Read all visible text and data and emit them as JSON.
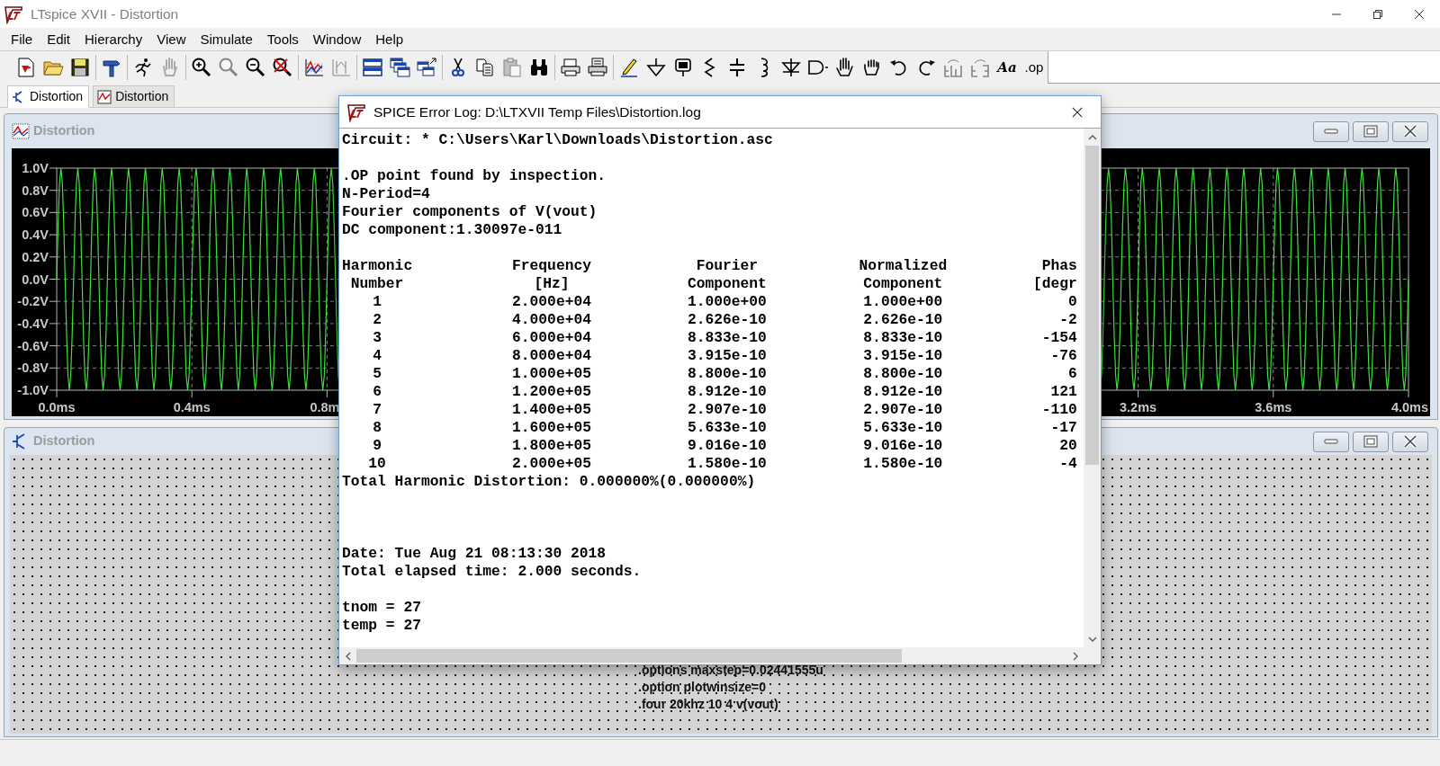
{
  "window": {
    "title": "LTspice XVII - Distortion"
  },
  "menu": [
    "File",
    "Edit",
    "Hierarchy",
    "View",
    "Simulate",
    "Tools",
    "Window",
    "Help"
  ],
  "toolbar": [
    {
      "disabled": false
    },
    {
      "disabled": false
    },
    {
      "disabled": false
    },
    {
      "disabled": false
    },
    {
      "disabled": false
    },
    {
      "disabled": true
    },
    {
      "disabled": false
    },
    {
      "disabled": true
    },
    {
      "disabled": false
    },
    {
      "disabled": false
    },
    {
      "disabled": false
    },
    {
      "disabled": true
    },
    {
      "disabled": false
    },
    {
      "disabled": false
    },
    {
      "disabled": false
    },
    {
      "disabled": false
    },
    {
      "disabled": false
    },
    {
      "disabled": true
    },
    {
      "disabled": false
    },
    {
      "disabled": false
    },
    {
      "disabled": false
    },
    {
      "disabled": false
    },
    {
      "disabled": false
    },
    {
      "disabled": false
    },
    {
      "disabled": false
    },
    {
      "disabled": false
    },
    {
      "disabled": false
    },
    {
      "disabled": false
    },
    {
      "disabled": false
    },
    {
      "disabled": false
    },
    {
      "disabled": false
    },
    {
      "disabled": false
    },
    {
      "disabled": false
    },
    {
      "disabled": true
    },
    {
      "disabled": true
    },
    {
      "disabled": false,
      "label": "Aa"
    },
    {
      "disabled": false,
      "label": ".op"
    }
  ],
  "tabs": [
    {
      "label": "Distortion",
      "kind": "schematic",
      "selected": true
    },
    {
      "label": "Distortion",
      "kind": "waveform",
      "selected": false
    }
  ],
  "waveform_window": {
    "title": "Distortion",
    "y_ticks": [
      "1.0V",
      "0.8V",
      "0.6V",
      "0.4V",
      "0.2V",
      "0.0V",
      "-0.2V",
      "-0.4V",
      "-0.6V",
      "-0.8V",
      "-1.0V"
    ],
    "x_ticks": [
      "0.0ms",
      "0.4ms",
      "0.8m",
      "3.2ms",
      "3.6ms",
      "4.0ms"
    ]
  },
  "schematic_window": {
    "title": "Distortion",
    "directives": [
      ".options maxstep=0.02441555u",
      ".option plotwinsize=0",
      ".four 20khz 10 4 v(vout)"
    ]
  },
  "log_dialog": {
    "title": "SPICE Error Log: D:\\LTXVII Temp Files\\Distortion.log",
    "content": [
      {
        "kind": "line",
        "text": "Circuit: * C:\\Users\\Karl\\Downloads\\Distortion.asc"
      },
      {
        "kind": "blank"
      },
      {
        "kind": "line",
        "text": ".OP point found by inspection."
      },
      {
        "kind": "line",
        "text": "N-Period=4"
      },
      {
        "kind": "line",
        "text": "Fourier components of V(vout)"
      },
      {
        "kind": "line",
        "text": "DC component:1.30097e-011"
      },
      {
        "kind": "blank"
      },
      {
        "kind": "table",
        "header_rows": [
          [
            "Harmonic",
            "Frequency",
            "Fourier",
            "Normalized",
            "Phas"
          ],
          [
            "Number",
            "[Hz]",
            "Component",
            "Component",
            "[degr"
          ]
        ],
        "rows": [
          [
            "1",
            "2.000e+04",
            "1.000e+00",
            "1.000e+00",
            "0"
          ],
          [
            "2",
            "4.000e+04",
            "2.626e-10",
            "2.626e-10",
            "-2"
          ],
          [
            "3",
            "6.000e+04",
            "8.833e-10",
            "8.833e-10",
            "-154"
          ],
          [
            "4",
            "8.000e+04",
            "3.915e-10",
            "3.915e-10",
            "-76"
          ],
          [
            "5",
            "1.000e+05",
            "8.800e-10",
            "8.800e-10",
            "6"
          ],
          [
            "6",
            "1.200e+05",
            "8.912e-10",
            "8.912e-10",
            "121"
          ],
          [
            "7",
            "1.400e+05",
            "2.907e-10",
            "2.907e-10",
            "-110"
          ],
          [
            "8",
            "1.600e+05",
            "5.633e-10",
            "5.633e-10",
            "-17"
          ],
          [
            "9",
            "1.800e+05",
            "9.016e-10",
            "9.016e-10",
            "20"
          ],
          [
            "10",
            "2.000e+05",
            "1.580e-10",
            "1.580e-10",
            "-4"
          ]
        ]
      },
      {
        "kind": "line",
        "text": "Total Harmonic Distortion: 0.000000%(0.000000%)"
      },
      {
        "kind": "blank"
      },
      {
        "kind": "blank"
      },
      {
        "kind": "blank"
      },
      {
        "kind": "line",
        "text": "Date: Tue Aug 21 08:13:30 2018"
      },
      {
        "kind": "line",
        "text": "Total elapsed time: 2.000 seconds."
      },
      {
        "kind": "blank"
      },
      {
        "kind": "line",
        "text": "tnom = 27"
      },
      {
        "kind": "line",
        "text": "temp = 27"
      }
    ]
  }
}
